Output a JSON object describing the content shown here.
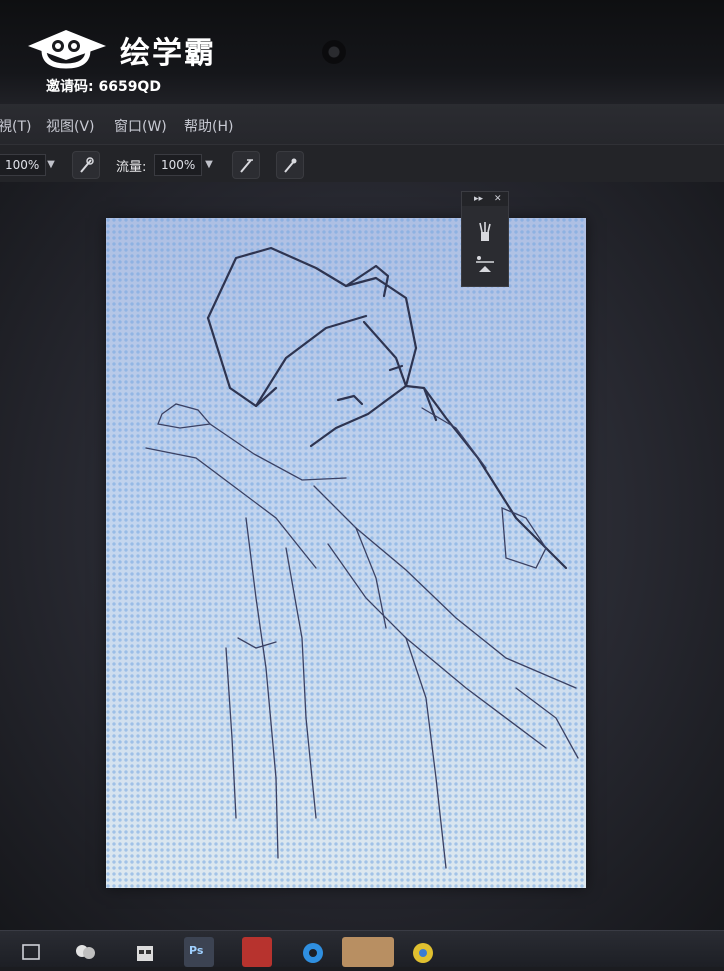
{
  "watermark": {
    "brand": "绘学霸",
    "invite": "邀请码: 6659QD",
    "logo_icon": "graduation-cap-cloud-icon"
  },
  "menubar": {
    "items": [
      {
        "label": "視(T)"
      },
      {
        "label": "视图(V)"
      },
      {
        "label": "窗口(W)"
      },
      {
        "label": "帮助(H)"
      }
    ]
  },
  "options_bar": {
    "opacity_value": "100%",
    "flow_label": "流量:",
    "flow_value": "100%",
    "icons": [
      "brush-airbrush-icon",
      "brush-pressure-icon",
      "brush-tablet-icon",
      "brush-settings-icon"
    ]
  },
  "floating_panel": {
    "collapse": "▸▸",
    "close": "✕",
    "tools": [
      "brush-presets-icon",
      "clone-source-icon"
    ]
  },
  "taskbar": {
    "items": [
      "task-view-icon",
      "app-icon",
      "store-icon",
      "photoshop-icon",
      "music-app-icon",
      "edge-browser-icon",
      "image-viewer-icon",
      "chrome-icon"
    ],
    "ps_label": "Ps"
  },
  "colors": {
    "workspace": "#2a2b31",
    "menubar": "#2b2c31",
    "canvas": "#c6d6ee",
    "watermark": "#ffffff"
  }
}
